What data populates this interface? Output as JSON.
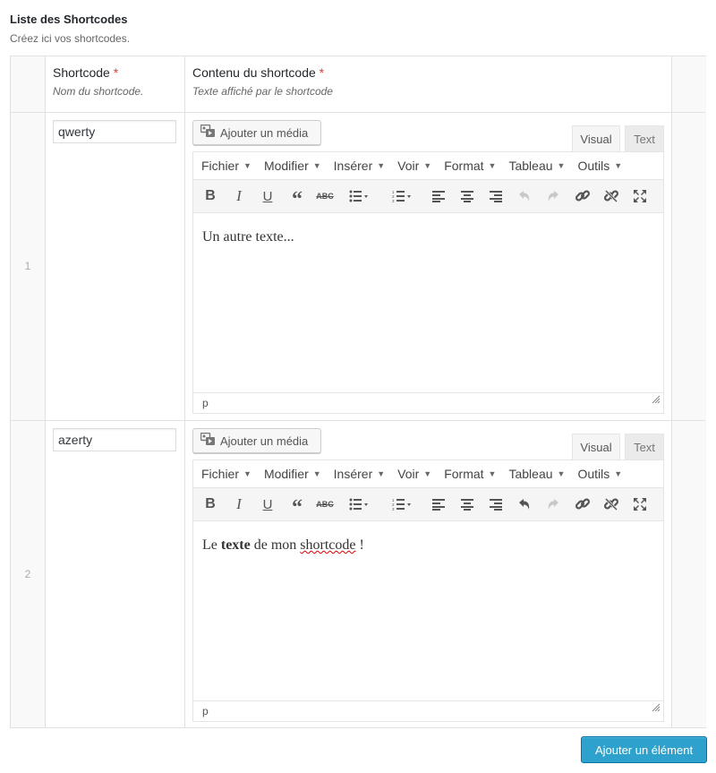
{
  "header": {
    "title": "Liste des Shortcodes",
    "description": "Créez ici vos shortcodes."
  },
  "columns": {
    "shortcode": {
      "label": "Shortcode",
      "required_mark": "*",
      "description": "Nom du shortcode."
    },
    "content": {
      "label": "Contenu du shortcode",
      "required_mark": "*",
      "description": "Texte affiché par le shortcode"
    }
  },
  "editor_ui": {
    "media_button": "Ajouter un média",
    "tab_visual": "Visual",
    "tab_text": "Text",
    "menus": [
      "Fichier",
      "Modifier",
      "Insérer",
      "Voir",
      "Format",
      "Tableau",
      "Outils"
    ],
    "status_path": "p",
    "toolbar_icons": [
      "bold-icon",
      "italic-icon",
      "underline-icon",
      "blockquote-icon",
      "strikethrough-icon",
      "bullet-list-icon",
      "numbered-list-icon",
      "align-left-icon",
      "align-center-icon",
      "align-right-icon",
      "undo-icon",
      "redo-icon",
      "link-icon",
      "unlink-icon",
      "fullscreen-icon"
    ]
  },
  "rows": [
    {
      "number": "1",
      "shortcode": "qwerty",
      "content": [
        {
          "text": "Un autre texte..."
        }
      ],
      "undo_enabled": false,
      "redo_enabled": false
    },
    {
      "number": "2",
      "shortcode": "azerty",
      "content": [
        {
          "text": "Le "
        },
        {
          "text": "texte",
          "bold": true
        },
        {
          "text": " de mon "
        },
        {
          "text": "shortcode",
          "spell": true
        },
        {
          "text": " !"
        }
      ],
      "undo_enabled": true,
      "redo_enabled": false
    }
  ],
  "footer": {
    "add_button": "Ajouter un élément"
  },
  "colors": {
    "primary_button": "#2ea2cc",
    "required": "#dd3d36"
  }
}
